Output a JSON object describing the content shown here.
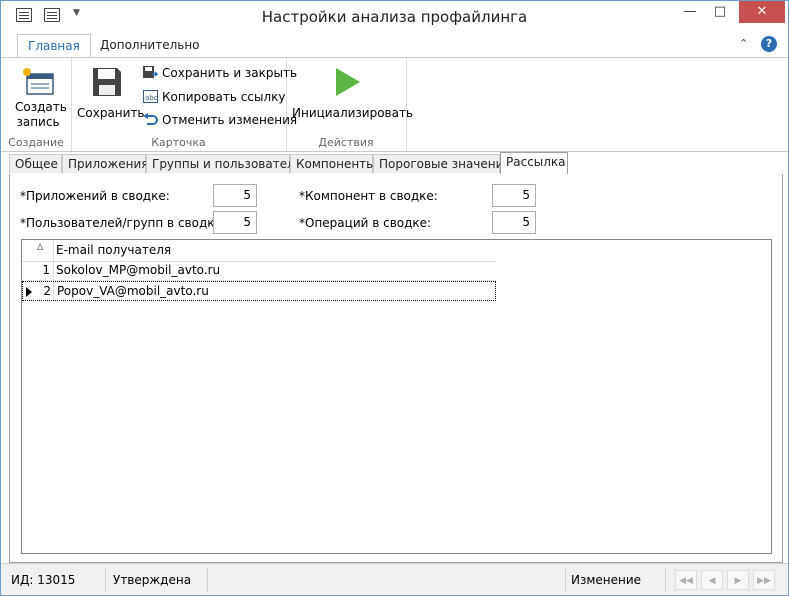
{
  "window": {
    "title": "Настройки анализа профайлинга"
  },
  "ribbon": {
    "tabs": [
      "Главная",
      "Дополнительно"
    ],
    "groups": {
      "create": {
        "label": "Создание",
        "create_record": "Создать\nзапись"
      },
      "card": {
        "label": "Карточка",
        "save": "Сохранить",
        "save_close": "Сохранить и закрыть",
        "copy_link": "Копировать ссылку",
        "cancel_changes": "Отменить изменения"
      },
      "actions": {
        "label": "Действия",
        "initialize": "Инициализировать"
      }
    }
  },
  "tabs": [
    "Общее",
    "Приложения",
    "Группы и пользователи",
    "Компоненты",
    "Пороговые значения",
    "Рассылка"
  ],
  "active_tab": "Рассылка",
  "fields": {
    "apps_in_summary": {
      "label": "*Приложений в сводке:",
      "value": "5"
    },
    "components_in_summary": {
      "label": "*Компонент в сводке:",
      "value": "5"
    },
    "users_in_summary": {
      "label": "*Пользователей/групп в сводке:",
      "value": "5"
    },
    "operations_in_summary": {
      "label": "*Операций в сводке:",
      "value": "5"
    }
  },
  "grid": {
    "column": "E-mail получателя",
    "rows": [
      {
        "num": "1",
        "email": "Sokolov_MP@mobil_avto.ru"
      },
      {
        "num": "2",
        "email": "Popov_VA@mobil_avto.ru"
      }
    ]
  },
  "status": {
    "id": "ИД: 13015",
    "state": "Утверждена",
    "mode": "Изменение"
  },
  "colors": {
    "accent": "#2b6cb3",
    "close": "#c75050",
    "play": "#5ab543"
  }
}
